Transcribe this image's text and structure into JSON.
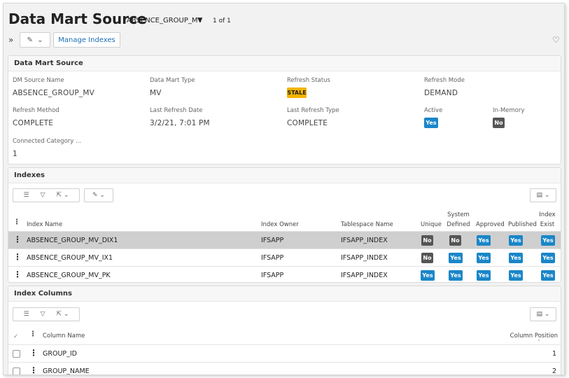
{
  "header": {
    "title": "Data Mart Source",
    "selector": "ABSENCE_GROUP_MV",
    "record_count": "1 of 1",
    "manage_indexes_label": "Manage Indexes"
  },
  "dm_panel": {
    "title": "Data Mart Source",
    "fields": {
      "dm_source_name": {
        "label": "DM Source Name",
        "value": "ABSENCE_GROUP_MV"
      },
      "data_mart_type": {
        "label": "Data Mart Type",
        "value": "MV"
      },
      "refresh_status": {
        "label": "Refresh Status",
        "value": "STALE"
      },
      "refresh_mode": {
        "label": "Refresh Mode",
        "value": "DEMAND"
      },
      "refresh_method": {
        "label": "Refresh Method",
        "value": "COMPLETE"
      },
      "last_refresh_date": {
        "label": "Last Refresh Date",
        "value": "3/2/21, 7:01 PM"
      },
      "last_refresh_type": {
        "label": "Last Refresh Type",
        "value": "COMPLETE"
      },
      "active": {
        "label": "Active",
        "value": "Yes"
      },
      "in_memory": {
        "label": "In-Memory",
        "value": "No"
      },
      "connected_category": {
        "label": "Connected Category ...",
        "value": "1"
      }
    }
  },
  "indexes": {
    "title": "Indexes",
    "columns": {
      "index_name": "Index Name",
      "index_owner": "Index Owner",
      "tablespace": "Tablespace Name",
      "unique": "Unique",
      "system_defined_1": "System",
      "system_defined_2": "Defined",
      "approved": "Approved",
      "published": "Published",
      "index_exist_1": "Index",
      "index_exist_2": "Exist"
    },
    "rows": [
      {
        "name": "ABSENCE_GROUP_MV_DIX1",
        "owner": "IFSAPP",
        "tablespace": "IFSAPP_INDEX",
        "unique": "No",
        "system_defined": "No",
        "approved": "Yes",
        "published": "Yes",
        "exist": "Yes"
      },
      {
        "name": "ABSENCE_GROUP_MV_IX1",
        "owner": "IFSAPP",
        "tablespace": "IFSAPP_INDEX",
        "unique": "No",
        "system_defined": "Yes",
        "approved": "Yes",
        "published": "Yes",
        "exist": "Yes"
      },
      {
        "name": "ABSENCE_GROUP_MV_PK",
        "owner": "IFSAPP",
        "tablespace": "IFSAPP_INDEX",
        "unique": "Yes",
        "system_defined": "Yes",
        "approved": "Yes",
        "published": "Yes",
        "exist": "Yes"
      }
    ]
  },
  "index_columns": {
    "title": "Index Columns",
    "columns": {
      "column_name": "Column Name",
      "column_position": "Column Position"
    },
    "rows": [
      {
        "name": "GROUP_ID",
        "position": "1"
      },
      {
        "name": "GROUP_NAME",
        "position": "2"
      }
    ]
  },
  "icons": [
    "expand-icon",
    "actions-icon",
    "heart-icon",
    "list-icon",
    "filter-icon",
    "export-icon",
    "column-chooser-icon",
    "kebab-icon",
    "checkmark-icon",
    "sort-asc-icon"
  ],
  "colors": {
    "yes_badge": "#1a86c8",
    "no_badge": "#555555",
    "stale_badge": "#f5b400",
    "link": "#1a6fb5"
  }
}
